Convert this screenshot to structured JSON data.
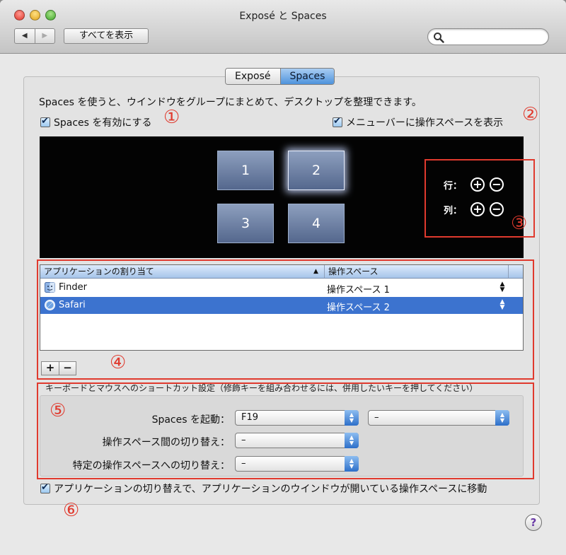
{
  "window": {
    "title": "Exposé と Spaces"
  },
  "toolbar": {
    "back_label": "◀",
    "forward_label": "▶",
    "show_all_label": "すべてを表示",
    "search_value": ""
  },
  "tabs": [
    {
      "label": "Exposé"
    },
    {
      "label": "Spaces"
    }
  ],
  "intro_text": "Spaces を使うと、ウインドウをグループにまとめて、デスクトップを整理できます。",
  "enable_spaces": {
    "label": "Spaces を有効にする",
    "checked": true
  },
  "menubar_option": {
    "label": "メニューバーに操作スペースを表示",
    "checked": true
  },
  "spaces": [
    {
      "label": "1"
    },
    {
      "label": "2"
    },
    {
      "label": "3"
    },
    {
      "label": "4"
    }
  ],
  "rows_cols": {
    "rows_label": "行：",
    "cols_label": "列：",
    "plus": "+",
    "minus": "−"
  },
  "table": {
    "columns": [
      "アプリケーションの割り当て",
      "操作スペース"
    ],
    "sort_indicator": "▲",
    "rows": [
      {
        "app": "Finder",
        "space": "操作スペース 1"
      },
      {
        "app": "Safari",
        "space": "操作スペース 2"
      }
    ],
    "add_label": "+",
    "remove_label": "−"
  },
  "shortcuts": {
    "group_title": "キーボードとマウスへのショートカット設定（修飾キーを組み合わせるには、併用したいキーを押してください）",
    "activate_label": "Spaces を起動：",
    "activate_value": "F19",
    "activate_mouse_value": "–",
    "switch_label": "操作スペース間の切り替え：",
    "switch_value": "–",
    "direct_label": "特定の操作スペースへの切り替え：",
    "direct_value": "–"
  },
  "app_switch_option": {
    "label": "アプリケーションの切り替えで、アプリケーションのウインドウが開いている操作スペースに移動",
    "checked": true
  },
  "callouts": [
    "①",
    "②",
    "③",
    "④",
    "⑤",
    "⑥"
  ],
  "help_label": "?",
  "colors": {
    "accent": "#3c73cf",
    "callout": "#e03a2e"
  }
}
